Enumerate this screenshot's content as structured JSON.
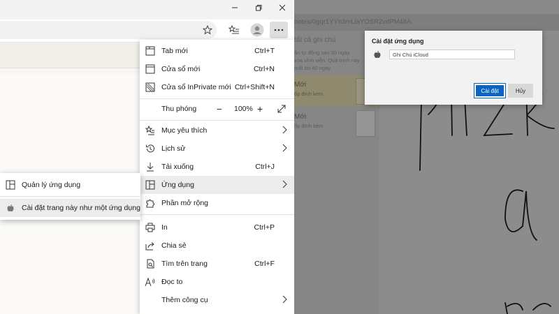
{
  "menu": {
    "new_tab": {
      "label": "Tab mới",
      "shortcut": "Ctrl+T"
    },
    "new_window": {
      "label": "Cửa sổ mới",
      "shortcut": "Ctrl+N"
    },
    "inprivate": {
      "label": "Cửa sổ InPrivate mới",
      "shortcut": "Ctrl+Shift+N"
    },
    "zoom": {
      "label": "Thu phóng",
      "minus": "−",
      "value": "100%",
      "plus": "+"
    },
    "favorites": {
      "label": "Mục yêu thích"
    },
    "history": {
      "label": "Lịch sử"
    },
    "downloads": {
      "label": "Tải xuống",
      "shortcut": "Ctrl+J"
    },
    "apps": {
      "label": "Ứng dụng"
    },
    "extensions": {
      "label": "Phần mở rộng"
    },
    "print": {
      "label": "In",
      "shortcut": "Ctrl+P"
    },
    "share": {
      "label": "Chia sẻ"
    },
    "find": {
      "label": "Tìm trên trang",
      "shortcut": "Ctrl+F"
    },
    "read_aloud": {
      "label": "Đọc to"
    },
    "more_tools": {
      "label": "Thêm công cụ"
    }
  },
  "submenu": {
    "manage_apps": "Quản lý ứng dụng",
    "install_site": "Cài đặt trang này như một ứng dụng"
  },
  "right_app": {
    "url": "notes/0gqr1YYh3mLlaYOSR2vdPM48A",
    "list_header": "tất cả ghi chú",
    "notice_lines": [
      "ẩn tự động sau 30 ngày.",
      "xóa vĩnh viễn. Quá trình này",
      "mất tới 40 ngày."
    ],
    "notes": [
      {
        "title": "Mới",
        "subtitle": "ốp đính kèm"
      },
      {
        "title": "Mới",
        "subtitle": "ốp đính kèm"
      }
    ],
    "handwriting_text": "pitz a ba"
  },
  "dialog": {
    "title": "Cài đặt ứng dụng",
    "app_name": "Ghi Chú iCloud",
    "install": "Cài đặt",
    "cancel": "Hủy"
  }
}
